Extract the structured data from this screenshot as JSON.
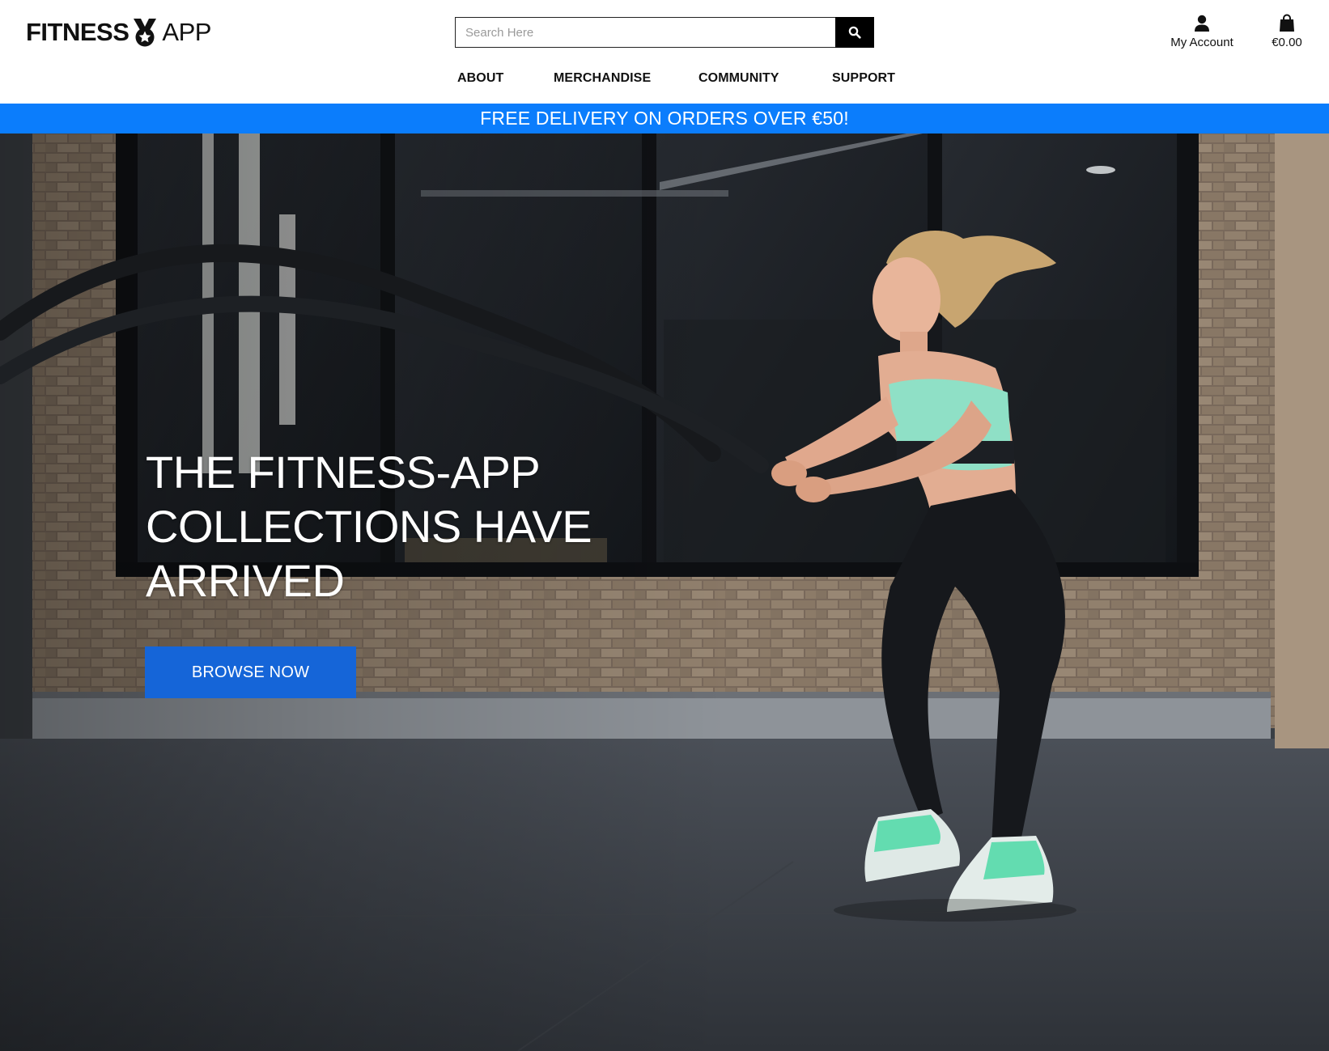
{
  "brand": {
    "name_bold": "FITNESS",
    "name_light": "APP",
    "logo_icon": "medal-icon"
  },
  "search": {
    "placeholder": "Search Here",
    "value": "",
    "button_icon": "search-icon"
  },
  "account": {
    "label": "My Account",
    "icon": "user-icon"
  },
  "cart": {
    "total": "€0.00",
    "icon": "shopping-bag-icon"
  },
  "nav": {
    "items": [
      {
        "label": "ABOUT"
      },
      {
        "label": "MERCHANDISE"
      },
      {
        "label": "COMMUNITY"
      },
      {
        "label": "SUPPORT"
      }
    ]
  },
  "banner": {
    "text": "FREE DELIVERY ON ORDERS OVER €50!",
    "color": "#0b7dfc"
  },
  "hero": {
    "title": "THE FITNESS-APP COLLECTIONS HAVE ARRIVED",
    "cta_label": "BROWSE NOW",
    "cta_color": "#1565d8"
  }
}
